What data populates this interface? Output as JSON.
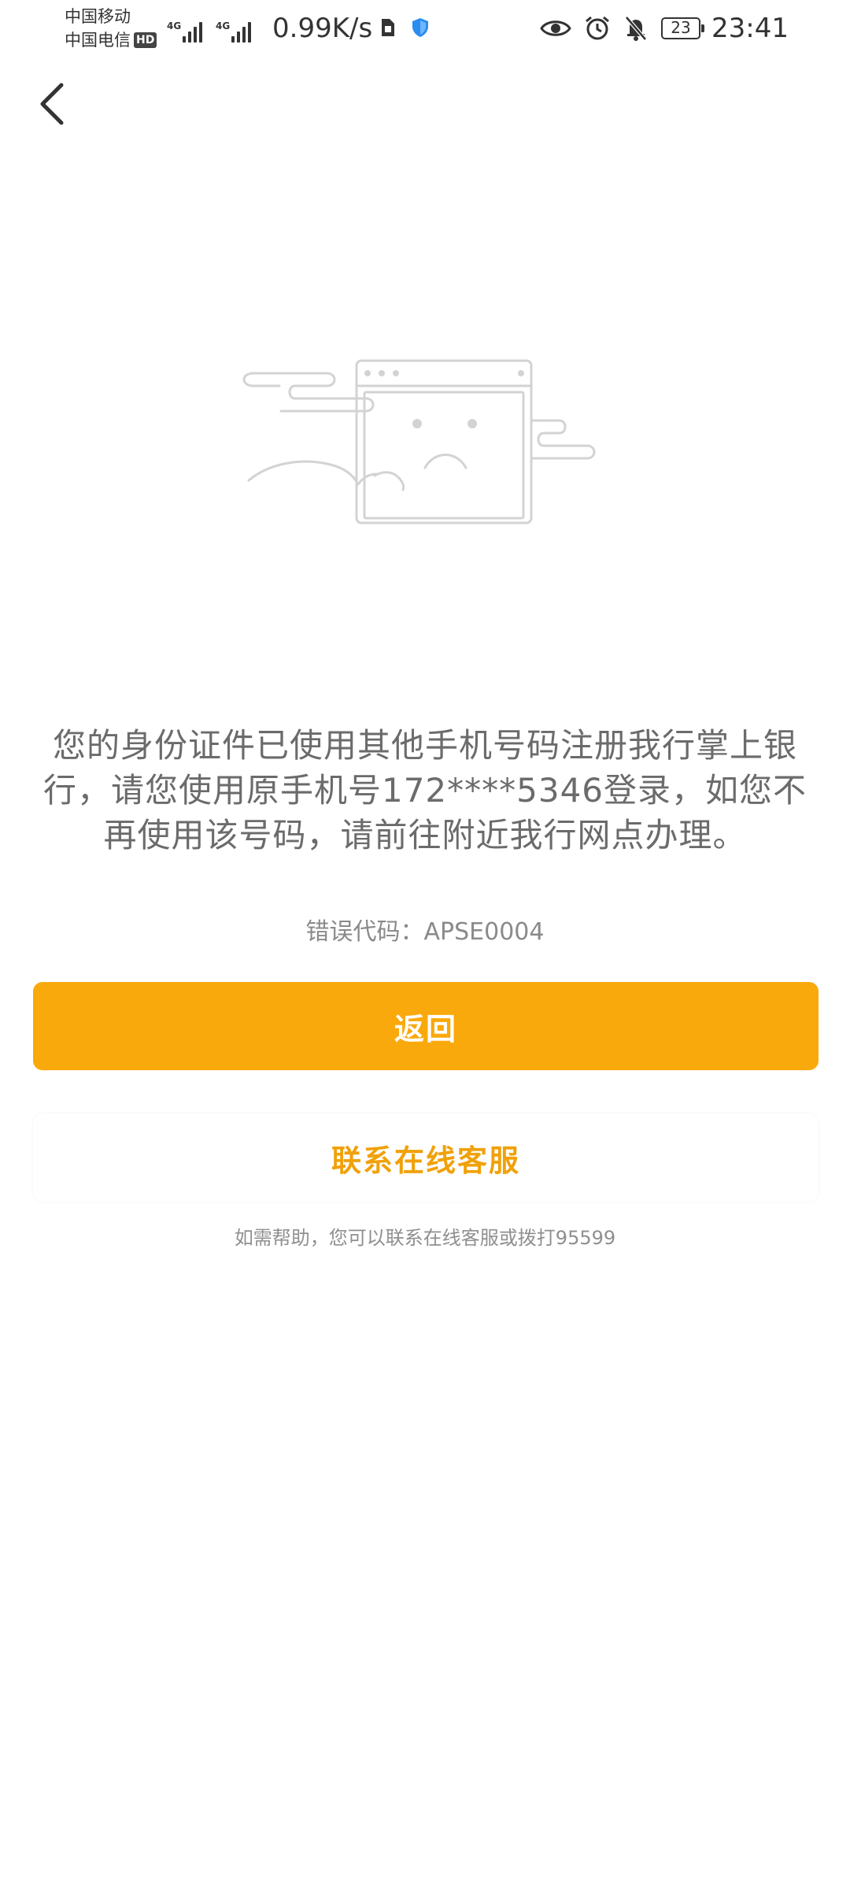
{
  "status_bar": {
    "carrier_1": "中国移动",
    "carrier_2": "中国电信",
    "hd_badge": "HD",
    "signal_1_tech": "4G",
    "signal_2_tech": "4G",
    "net_speed": "0.99K/s",
    "battery_level": "23",
    "time": "23:41",
    "icons": [
      "sim-card-icon",
      "shield-icon",
      "eye-icon",
      "alarm-icon",
      "bell-muted-icon",
      "battery-icon"
    ]
  },
  "nav": {
    "back_icon": "chevron-left-icon"
  },
  "illustration": {
    "icon": "sad-browser-window-icon"
  },
  "content": {
    "message": "您的身份证件已使用其他手机号码注册我行掌上银行，请您使用原手机号172****5346登录，如您不再使用该号码，请前往附近我行网点办理。",
    "error_code": "错误代码：APSE0004"
  },
  "actions": {
    "back_label": "返回",
    "contact_label": "联系在线客服"
  },
  "help": {
    "text": "如需帮助，您可以联系在线客服或拨打95599"
  },
  "colors": {
    "primary": "#f9a90b",
    "secondary_text": "#f0a10a",
    "body_text": "#6b6b6b"
  }
}
